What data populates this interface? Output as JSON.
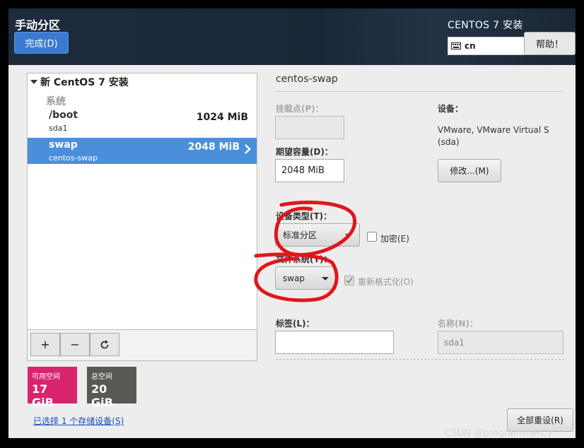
{
  "header": {
    "title": "手动分区",
    "done_button": "完成(D)",
    "product_title": "CENTOS 7 安装",
    "keyboard_layout": "cn",
    "help_button": "帮助！"
  },
  "partitions": {
    "install_title": "新 CentOS 7 安装",
    "group_label": "系统",
    "items": [
      {
        "name": "/boot",
        "device": "sda1",
        "size": "1024 MiB",
        "selected": false
      },
      {
        "name": "swap",
        "device": "centos-swap",
        "size": "2048 MiB",
        "selected": true
      }
    ],
    "toolbar": {
      "add": "+",
      "remove": "−",
      "refresh": "⟳"
    }
  },
  "space": {
    "available_label": "可用空间",
    "available_value": "17 GiB",
    "total_label": "总空间",
    "total_value": "20 GiB"
  },
  "storage_link": "已选择 1 个存储设备(S)",
  "details": {
    "title": "centos-swap",
    "mount_point_label": "挂载点(P)：",
    "mount_point_value": "",
    "capacity_label": "期望容量(D)：",
    "capacity_value": "2048 MiB",
    "device_label": "设备：",
    "device_value_line1": "VMware, VMware Virtual S",
    "device_value_line2": "(sda)",
    "modify_button": "修改...(M)",
    "device_type_label": "设备类型(T)：",
    "device_type_value": "标准分区",
    "encrypt_label": "加密(E)",
    "filesystem_label": "文件系统(Y)：",
    "filesystem_value": "swap",
    "reformat_label": "重新格式化(O)",
    "tag_label": "标签(L)：",
    "tag_value": "",
    "name_label": "名称(N)：",
    "name_value": "sda1",
    "reset_button": "全部重设(R)"
  },
  "watermark": "CSDN @programmerCy",
  "colors": {
    "accent": "#4a8fdc",
    "available_tile": "#d7246c",
    "total_tile": "#565a53",
    "annotation": "#e0161a"
  }
}
